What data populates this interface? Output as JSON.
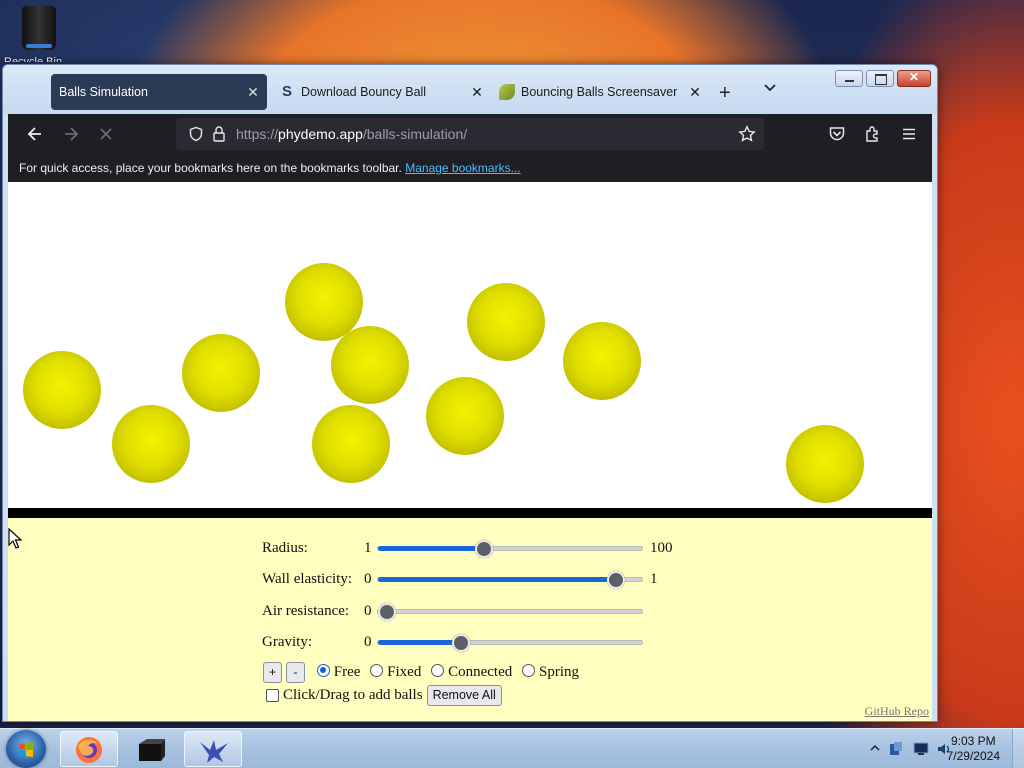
{
  "desktop": {
    "icon_label": "Recycle Bin"
  },
  "browser": {
    "tabs": [
      {
        "title": "Balls Simulation",
        "active": true
      },
      {
        "title": "Download Bouncy Ball",
        "active": false,
        "favicon": "s-logo"
      },
      {
        "title": "Bouncing Balls Screensaver for",
        "active": false,
        "favicon": "leaf-logo"
      }
    ],
    "new_tab_label": "+",
    "url_prefix": "https://",
    "url_host": "phydemo.app",
    "url_path": "/balls-simulation/",
    "bookmarks_message": "For quick access, place your bookmarks here on the bookmarks toolbar.",
    "bookmarks_link": "Manage bookmarks..."
  },
  "simulation": {
    "ball_color": "#e0df00",
    "ball_count": 10,
    "floor_color": "#000000",
    "panel_color": "#ffffc0"
  },
  "controls": {
    "radius": {
      "label": "Radius:",
      "min": "1",
      "max": "100",
      "value": 40
    },
    "wall_elasticity": {
      "label": "Wall elasticity:",
      "min": "0",
      "max": "1",
      "value": 0.93
    },
    "air_resistance": {
      "label": "Air resistance:",
      "min": "0",
      "value": 0
    },
    "gravity": {
      "label": "Gravity:",
      "min": "0",
      "value": 0.3
    },
    "plus_label": "+",
    "minus_label": "-",
    "modes": [
      {
        "label": "Free",
        "checked": true
      },
      {
        "label": "Fixed",
        "checked": false
      },
      {
        "label": "Connected",
        "checked": false
      },
      {
        "label": "Spring",
        "checked": false
      }
    ],
    "click_drag_label": "Click/Drag to add balls",
    "remove_all_label": "Remove All",
    "github_link": "GitHub Repo"
  },
  "taskbar": {
    "time": "9:03 PM",
    "date": "7/29/2024",
    "apps": [
      "firefox",
      "terminal",
      "bird-app"
    ]
  }
}
